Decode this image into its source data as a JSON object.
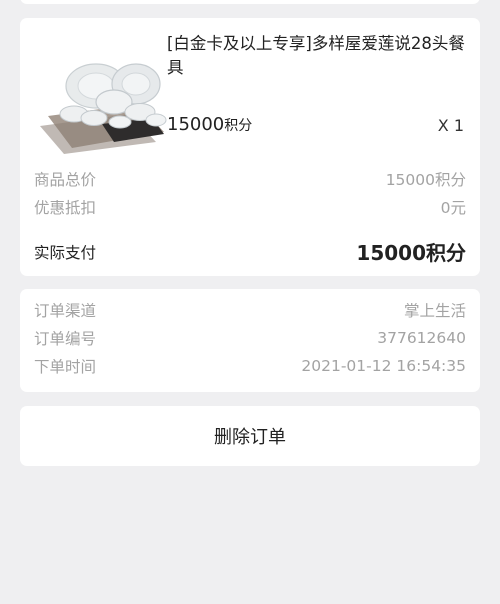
{
  "product": {
    "title": "[白金卡及以上专享]多样屋爱莲说28头餐具",
    "price": "15000",
    "price_unit": "积分",
    "quantity": "X 1"
  },
  "summary": {
    "rows": [
      {
        "label": "商品总价",
        "value": "15000积分"
      },
      {
        "label": "优惠抵扣",
        "value": "0元"
      }
    ],
    "actual_label": "实际支付",
    "actual_value": "15000积分"
  },
  "order_info": {
    "rows": [
      {
        "label": "订单渠道",
        "value": "掌上生活"
      },
      {
        "label": "订单编号",
        "value": "377612640"
      },
      {
        "label": "下单时间",
        "value": "2021-01-12 16:54:35"
      }
    ]
  },
  "actions": {
    "delete_label": "删除订单"
  }
}
